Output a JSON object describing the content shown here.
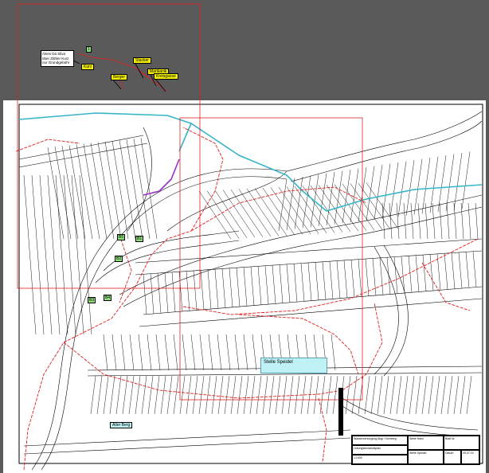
{
  "note": {
    "lines": [
      "Alves Da Silva",
      "über Zähler Kurz",
      "nur Grundgebühr"
    ]
  },
  "tags": {
    "kurz": "Kurz",
    "stacker": "Stacker",
    "berger": "Berger",
    "marikanik": "Marikanik",
    "kreisgasse": "Kreisgasse",
    "small_green": "1",
    "green_a": "B1",
    "green_b": "B2",
    "green_c": "B3",
    "green_d": "B4",
    "green_e": "B5"
  },
  "callouts": {
    "stelle_speidel": "Stelle Speidel",
    "alter_berg": "Alter Berg"
  },
  "titleblock": {
    "project": "Wasserversorgung Abgr. Hornberg",
    "subtitle": "Leitungsbestandsplan",
    "scale": "1:1000",
    "label_a": "Stelle Hahn",
    "label_b": "Stelle Speidel",
    "label_date": "Datum:",
    "date": "05.07.15",
    "label_sheet": "Blatt Nr."
  },
  "colors": {
    "background": "#5a5a5a",
    "sheet": "#ffffff",
    "parcel_lines": "#000000",
    "water_line": "#e02020",
    "creek": "#36b5c8",
    "purple_segment": "#9b30c8",
    "highlight_yellow": "#f4f000",
    "highlight_green": "#8ee07a",
    "callout_cyan": "#bff2f7"
  }
}
